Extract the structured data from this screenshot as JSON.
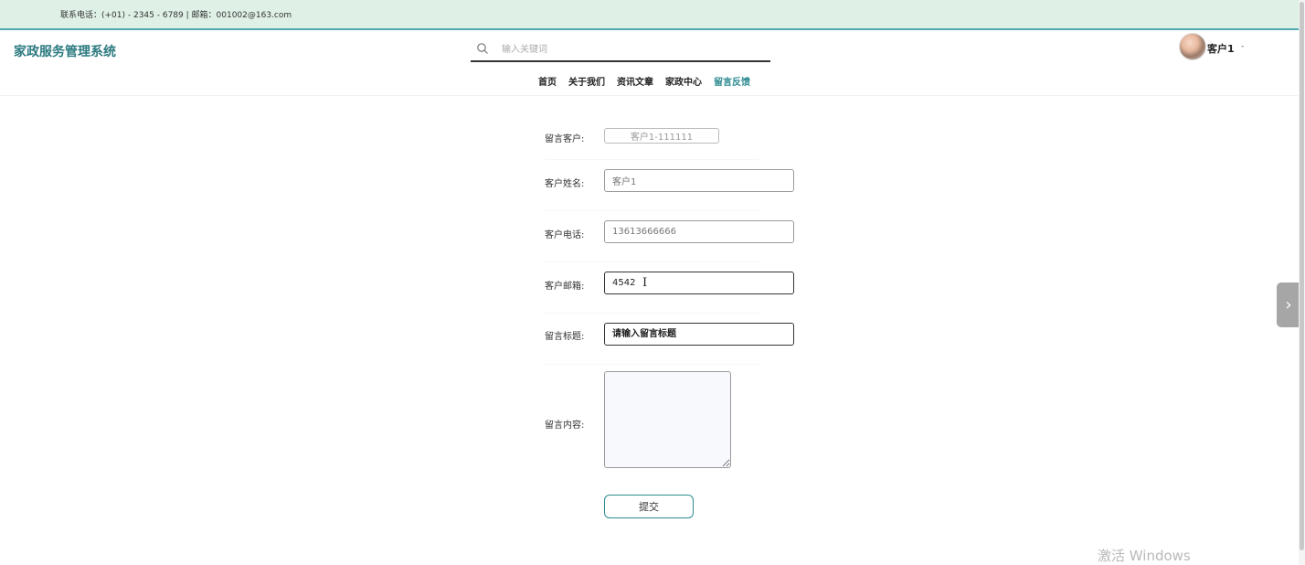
{
  "topbar": {
    "contact": "联系电话：(+01) - 2345 - 6789 | 邮箱：001002@163.com"
  },
  "header": {
    "brand": "家政服务管理系统",
    "search_placeholder": "输入关键词",
    "user_name": "客户1",
    "caret": "-"
  },
  "nav": {
    "items": [
      "首页",
      "关于我们",
      "资讯文章",
      "家政中心",
      "留言反馈"
    ],
    "active_index": 4
  },
  "form": {
    "customer_label": "留言客户:",
    "customer_value": "客户1-111111",
    "name_label": "客户姓名:",
    "name_value": "客户1",
    "phone_label": "客户电话:",
    "phone_value": "13613666666",
    "email_label": "客户邮箱:",
    "email_value": "4542",
    "title_label": "留言标题:",
    "title_placeholder": "请输入留言标题",
    "content_label": "留言内容:",
    "submit_label": "提交"
  },
  "side_handle": {
    "glyph": "›"
  },
  "watermark": "激活 Windows"
}
